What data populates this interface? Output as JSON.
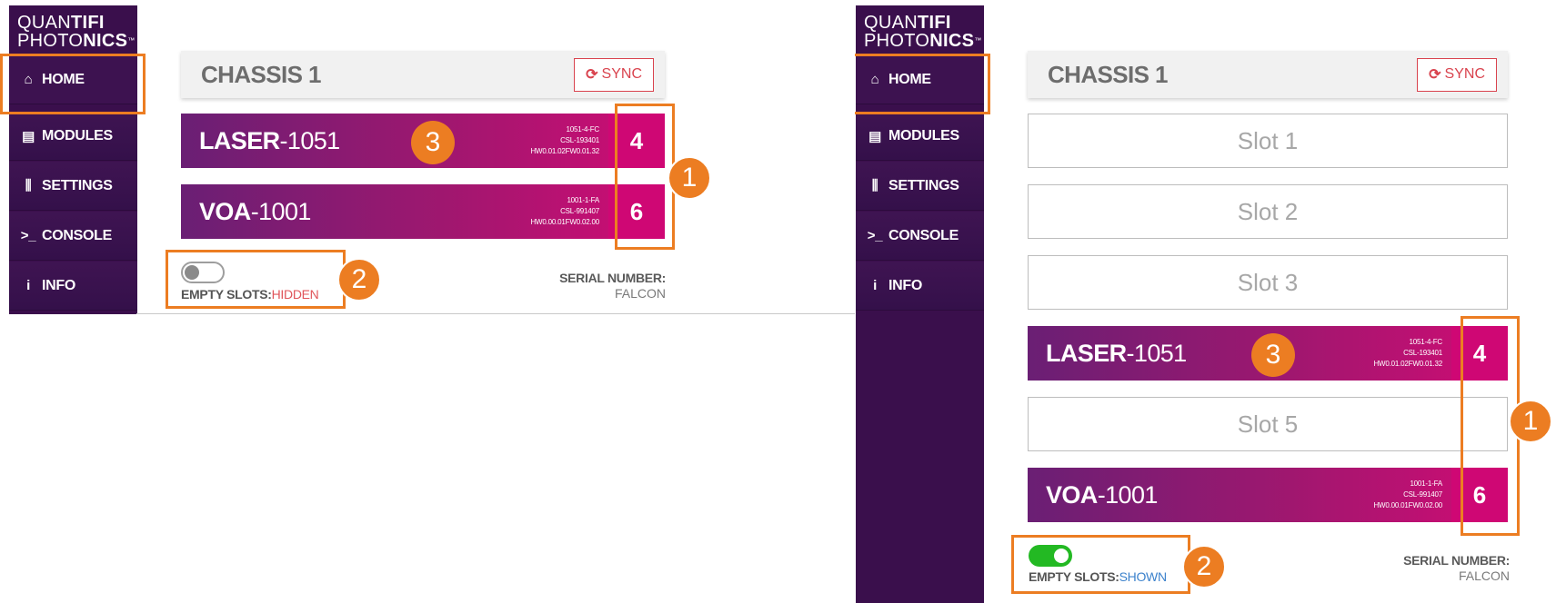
{
  "logo": {
    "line1_light": "QUAN",
    "line1_bold": "TIFI",
    "line2_light": "PHOTO",
    "line2_bold": "NICS",
    "tm": "™"
  },
  "nav": {
    "home": "HOME",
    "modules": "MODULES",
    "settings": "SETTINGS",
    "console": "CONSOLE",
    "info": "INFO",
    "icons": {
      "home": "home-icon",
      "modules": "modules-icon",
      "settings": "settings-sliders-icon",
      "console": "console-prompt-icon",
      "info": "info-icon"
    }
  },
  "chassis": {
    "title": "CHASSIS 1",
    "sync_label": "SYNC",
    "sync_icon": "⟳"
  },
  "modules": [
    {
      "name_bold": "LASER",
      "name_rest": "-1051",
      "meta1": "1051-4-FC",
      "meta2": "CSL-193401",
      "meta3": "HW0.01.02FW0.01.32",
      "slot": "4"
    },
    {
      "name_bold": "VOA",
      "name_rest": "-1001",
      "meta1": "1001-1-FA",
      "meta2": "CSL-991407",
      "meta3": "HW0.00.01FW0.02.00",
      "slot": "6"
    }
  ],
  "empty_slots": [
    "Slot 1",
    "Slot 2",
    "Slot 3",
    "Slot 5"
  ],
  "empty_slots_toggle": {
    "label": "EMPTY SLOTS:",
    "left_state": "HIDDEN",
    "right_state": "SHOWN"
  },
  "serial": {
    "label": "SERIAL NUMBER:",
    "value": "FALCON"
  },
  "callouts": [
    "1",
    "2",
    "3"
  ],
  "colors": {
    "sidebar": "#3a0f4c",
    "module_gradient_start": "#6a1f74",
    "module_gradient_end": "#cf0c74",
    "accent_orange": "#ec7d22",
    "sync_red": "#d9434e",
    "toggle_on": "#23b923"
  }
}
